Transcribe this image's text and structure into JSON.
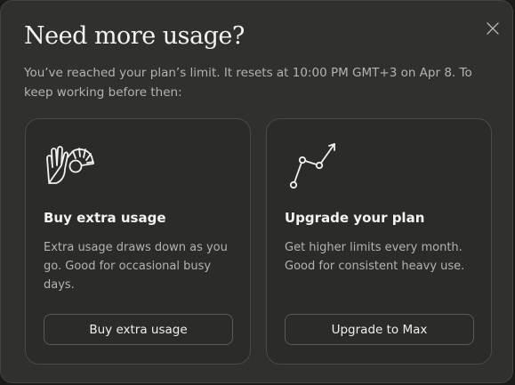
{
  "modal": {
    "title": "Need more usage?",
    "subtitle": "You’ve reached your plan’s limit. It resets at 10:00 PM GMT+3 on Apr 8. To keep working before then:",
    "close_icon": "close-icon"
  },
  "cards": [
    {
      "icon": "hand-gauge-icon",
      "title": "Buy extra usage",
      "description": "Extra usage draws down as you go. Good for occasional busy days.",
      "button_label": "Buy extra usage"
    },
    {
      "icon": "trend-up-icon",
      "title": "Upgrade your plan",
      "description": "Get higher limits every month. Good for consistent heavy use.",
      "button_label": "Upgrade to Max"
    }
  ],
  "colors": {
    "background": "#30302e",
    "card_background": "#2b2b29",
    "border": "#4a4a48",
    "text_primary": "#f5f3ee",
    "text_secondary": "#b5b3ad"
  }
}
